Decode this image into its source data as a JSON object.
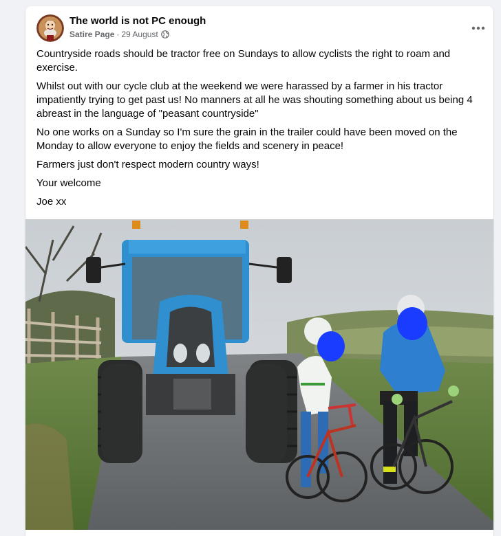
{
  "post": {
    "page_name": "The world is not PC enough",
    "badge": "Satire Page",
    "separator": "·",
    "date": "29 August",
    "privacy_icon": "globe-icon",
    "more_icon": "more-options-icon",
    "paragraphs": [
      "Countryside roads should be tractor free on Sundays to allow cyclists the right to roam and exercise.",
      "Whilst out with our cycle club at the weekend we were harassed by a farmer in his tractor impatiently trying to get past us! No manners at all he was shouting something about us being 4 abreast in the language of \"peasant countryside\"",
      "No one works on a Sunday so I'm sure the grain in the trailer could have been moved on the Monday to allow everyone to enjoy the fields and scenery in peace!",
      "Farmers just don't respect modern country ways!",
      "Your welcome",
      "Joe xx"
    ]
  },
  "colors": {
    "text_primary": "#050505",
    "text_secondary": "#65676b",
    "background": "#f0f2f5",
    "card": "#ffffff",
    "tractor_blue": "#2f8fcf",
    "redaction_blue": "#1a3cff"
  }
}
